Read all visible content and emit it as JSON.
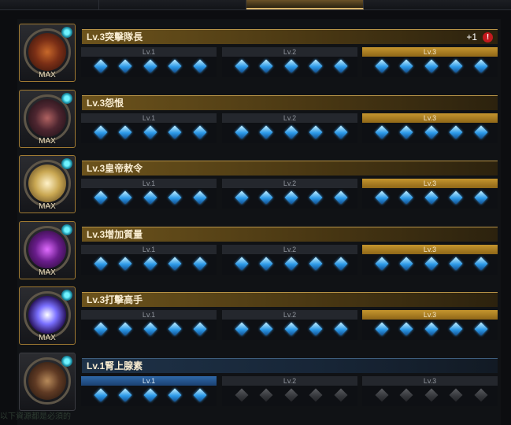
{
  "rows": [
    {
      "title": "Lv.3突擊隊長",
      "max_label": "MAX",
      "maxed": true,
      "plus": "+1",
      "alert": "!",
      "orb": "radial-gradient(circle,#c7682a 0%,#7b2f16 45%,#2b100b 100%)"
    },
    {
      "title": "Lv.3怨恨",
      "max_label": "MAX",
      "maxed": true,
      "plus": "",
      "alert": "",
      "orb": "radial-gradient(circle,#b06261 0%,#4e2630 45%,#150d12 100%)"
    },
    {
      "title": "Lv.3皇帝敕令",
      "max_label": "MAX",
      "maxed": true,
      "plus": "",
      "alert": "",
      "orb": "radial-gradient(circle,#fff2c8 0%,#c9a752 45%,#4b3617 100%)"
    },
    {
      "title": "Lv.3增加質量",
      "max_label": "MAX",
      "maxed": true,
      "plus": "",
      "alert": "",
      "orb": "radial-gradient(circle,#e06cff 0%,#6a1d8c 45%,#1d0925 100%)"
    },
    {
      "title": "Lv.3打擊高手",
      "max_label": "MAX",
      "maxed": true,
      "plus": "",
      "alert": "",
      "orb": "radial-gradient(circle,#ffffff 0%,#7a70ff 35%,#2a1560 70%,#0b0718 100%)"
    },
    {
      "title": "Lv.1腎上腺素",
      "max_label": "",
      "maxed": false,
      "plus": "",
      "alert": "",
      "orb": "radial-gradient(circle,#b78a5a 0%,#5f3a24 45%,#1d120c 100%)"
    }
  ],
  "levels": [
    "Lv.1",
    "Lv.2",
    "Lv.3"
  ],
  "gems_per_level": 5,
  "footer_text": "以下資源都是必須的"
}
